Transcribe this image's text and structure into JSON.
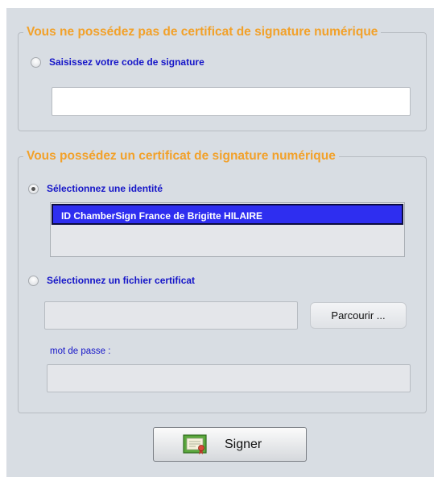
{
  "group_no_certificate": {
    "legend": "Vous ne possédez pas de certificat de signature numérique",
    "radio_label": "Saisissez votre code de signature",
    "radio_checked": false,
    "code_input_value": ""
  },
  "group_certificate": {
    "legend": "Vous possédez un certificat de signature numérique",
    "identity_radio_label": "Sélectionnez une identité",
    "identity_radio_checked": true,
    "identities": [
      "ID ChamberSign France de Brigitte HILAIRE"
    ],
    "selected_identity_index": 0,
    "file_radio_label": "Sélectionnez un fichier certificat",
    "file_radio_checked": false,
    "file_input_value": "",
    "browse_label": "Parcourir ...",
    "password_label": "mot de passe :",
    "password_value": ""
  },
  "actions": {
    "sign_label": "Signer",
    "sign_icon": "certificate-icon"
  },
  "colors": {
    "legend": "#f2a12a",
    "label_blue": "#1515c8",
    "selection": "#2e2ef0",
    "panel_bg": "#d8dde3"
  }
}
